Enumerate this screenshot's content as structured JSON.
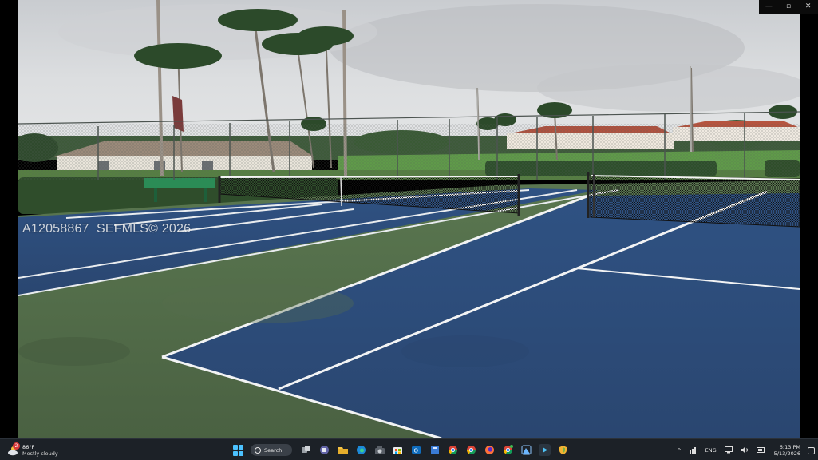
{
  "window": {
    "controls": {
      "minimize": "—",
      "restore": "▫",
      "close": "✕"
    }
  },
  "photo": {
    "watermark": "A12058867  SEFMLS© 2026"
  },
  "taskbar": {
    "weather": {
      "badge": "2",
      "temperature": "86°F",
      "condition": "Mostly cloudy"
    },
    "search_label": "Search",
    "pinned_apps": [
      "task-view",
      "teams",
      "file-explorer",
      "edge",
      "camera",
      "store",
      "outlook",
      "calculator",
      "chrome-1",
      "chrome-2",
      "firefox",
      "chrome-3",
      "photos",
      "media-player",
      "security"
    ],
    "tray": {
      "chevron": "^",
      "language": "ENG",
      "time": "6:13 PM",
      "date": "5/13/2026"
    }
  },
  "colors": {
    "court_blue": "#2e4f7d",
    "court_green": "#4e6b47",
    "sky": "#d6d9dc",
    "taskbar": "#1c2127"
  }
}
